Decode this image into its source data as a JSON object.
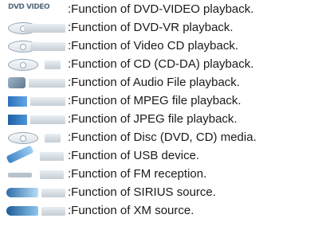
{
  "separator": ":",
  "rows": [
    {
      "icon": "dvd-video-logo-icon",
      "logo_text": "DVD VIDEO",
      "label": "Function of DVD-VIDEO playback."
    },
    {
      "icon": "dvd-vr-disc-icon",
      "label": "Function of DVD-VR playback."
    },
    {
      "icon": "video-cd-disc-icon",
      "label": "Function of Video CD playback."
    },
    {
      "icon": "cd-disc-icon",
      "label": "Function of CD (CD-DA) playback."
    },
    {
      "icon": "audio-file-icon",
      "label": "Function of Audio File playback."
    },
    {
      "icon": "mpeg-file-icon",
      "label": "Function of MPEG file playback."
    },
    {
      "icon": "jpeg-file-icon",
      "label": "Function of JPEG file playback."
    },
    {
      "icon": "disc-media-icon",
      "label": "Function of Disc (DVD, CD) media."
    },
    {
      "icon": "usb-device-icon",
      "label": "Function of USB device."
    },
    {
      "icon": "fm-reception-icon",
      "label": "Function of FM reception."
    },
    {
      "icon": "sirius-source-icon",
      "label": "Function of SIRIUS source."
    },
    {
      "icon": "xm-source-icon",
      "label": "Function of XM source."
    }
  ]
}
